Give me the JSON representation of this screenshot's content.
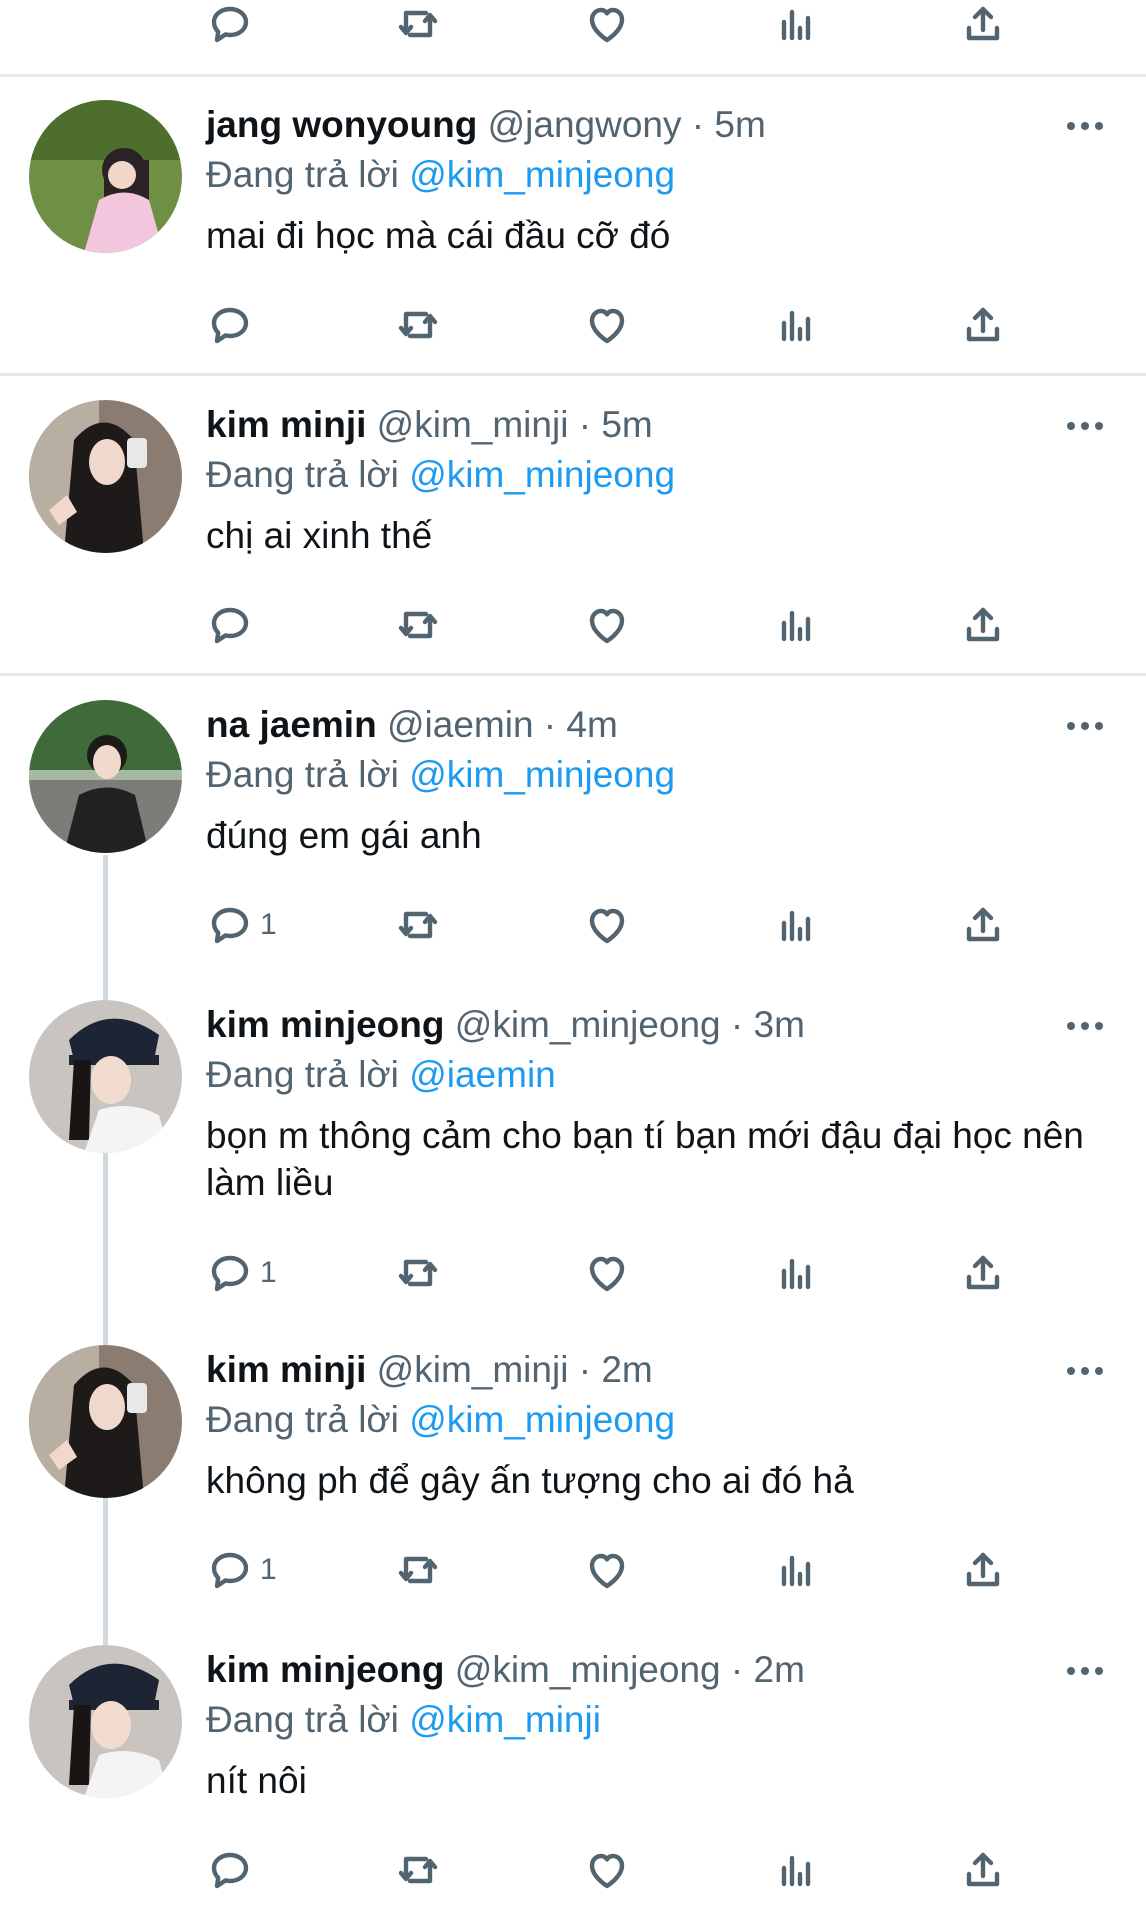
{
  "reply_prefix": "Đang trả lời",
  "accent_color": "#1d9bf0",
  "icons": {
    "reply": "reply-bubble-icon",
    "retweet": "retweet-icon",
    "like": "heart-icon",
    "views": "bar-chart-icon",
    "share": "share-icon",
    "more": "more-dots-icon"
  },
  "tweets": [
    {
      "name": "jang wonyoung",
      "handle": "@jangwony",
      "time": "5m",
      "reply_to": "@kim_minjeong",
      "text": "mai đi học mà cái đầu cỡ đó",
      "reply_count": ""
    },
    {
      "name": "kim minji",
      "handle": "@kim_minji",
      "time": "5m",
      "reply_to": "@kim_minjeong",
      "text": "chị ai xinh thế",
      "reply_count": ""
    },
    {
      "name": "na jaemin",
      "handle": "@iaemin",
      "time": "4m",
      "reply_to": "@kim_minjeong",
      "text": "đúng em gái anh",
      "reply_count": "1"
    },
    {
      "name": "kim minjeong",
      "handle": "@kim_minjeong",
      "time": "3m",
      "reply_to": "@iaemin",
      "text": "bọn m thông cảm cho bạn tí bạn mới đậu đại học nên làm liều",
      "reply_count": "1"
    },
    {
      "name": "kim minji",
      "handle": "@kim_minji",
      "time": "2m",
      "reply_to": "@kim_minjeong",
      "text": "không ph để gây ấn tượng cho ai đó hả",
      "reply_count": "1"
    },
    {
      "name": "kim minjeong",
      "handle": "@kim_minjeong",
      "time": "2m",
      "reply_to": "@kim_minji",
      "text": "nít nôi",
      "reply_count": ""
    }
  ]
}
